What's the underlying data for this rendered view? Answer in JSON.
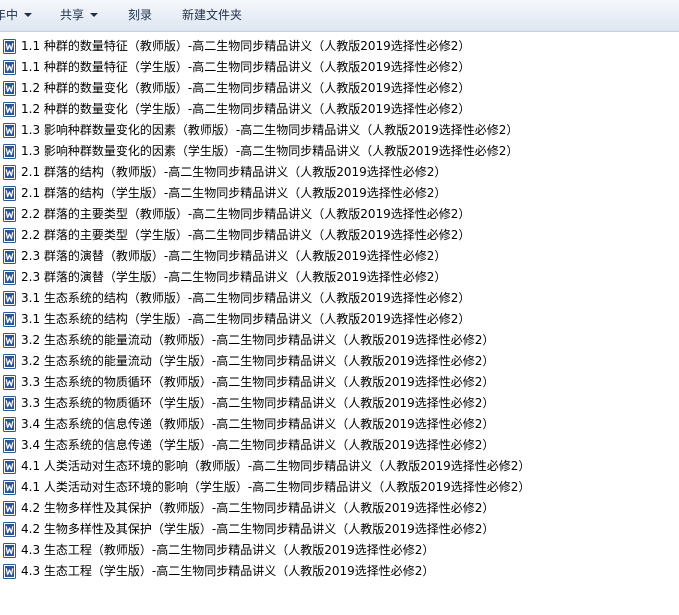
{
  "toolbar": {
    "items": [
      {
        "label": "年中",
        "dropdown": true
      },
      {
        "label": "共享",
        "dropdown": true
      },
      {
        "label": "刻录",
        "dropdown": false
      },
      {
        "label": "新建文件夹",
        "dropdown": false
      }
    ]
  },
  "files": {
    "icon": "word-document-icon",
    "icon_color": "#2b5797",
    "items": [
      {
        "name": "1.1 种群的数量特征（教师版）-高二生物同步精品讲义（人教版2019选择性必修2）"
      },
      {
        "name": "1.1 种群的数量特征（学生版）-高二生物同步精品讲义（人教版2019选择性必修2）"
      },
      {
        "name": "1.2 种群的数量变化（教师版）-高二生物同步精品讲义（人教版2019选择性必修2）"
      },
      {
        "name": "1.2 种群的数量变化（学生版）-高二生物同步精品讲义（人教版2019选择性必修2）"
      },
      {
        "name": "1.3 影响种群数量变化的因素（教师版）-高二生物同步精品讲义（人教版2019选择性必修2）"
      },
      {
        "name": "1.3 影响种群数量变化的因素（学生版）-高二生物同步精品讲义（人教版2019选择性必修2）"
      },
      {
        "name": "2.1 群落的结构（教师版）-高二生物同步精品讲义（人教版2019选择性必修2）"
      },
      {
        "name": "2.1 群落的结构（学生版）-高二生物同步精品讲义（人教版2019选择性必修2）"
      },
      {
        "name": "2.2 群落的主要类型（教师版）-高二生物同步精品讲义（人教版2019选择性必修2）"
      },
      {
        "name": "2.2 群落的主要类型（学生版）-高二生物同步精品讲义（人教版2019选择性必修2）"
      },
      {
        "name": "2.3 群落的演替（教师版）-高二生物同步精品讲义（人教版2019选择性必修2）"
      },
      {
        "name": "2.3 群落的演替（学生版）-高二生物同步精品讲义（人教版2019选择性必修2）"
      },
      {
        "name": "3.1 生态系统的结构（教师版）-高二生物同步精品讲义（人教版2019选择性必修2）"
      },
      {
        "name": "3.1 生态系统的结构（学生版）-高二生物同步精品讲义（人教版2019选择性必修2）"
      },
      {
        "name": "3.2 生态系统的能量流动（教师版）-高二生物同步精品讲义（人教版2019选择性必修2）"
      },
      {
        "name": "3.2 生态系统的能量流动（学生版）-高二生物同步精品讲义（人教版2019选择性必修2）"
      },
      {
        "name": "3.3 生态系统的物质循环（教师版）-高二生物同步精品讲义（人教版2019选择性必修2）"
      },
      {
        "name": "3.3 生态系统的物质循环（学生版）-高二生物同步精品讲义（人教版2019选择性必修2）"
      },
      {
        "name": "3.4 生态系统的信息传递（教师版）-高二生物同步精品讲义（人教版2019选择性必修2）"
      },
      {
        "name": "3.4 生态系统的信息传递（学生版）-高二生物同步精品讲义（人教版2019选择性必修2）"
      },
      {
        "name": "4.1 人类活动对生态环境的影响（教师版）-高二生物同步精品讲义（人教版2019选择性必修2）"
      },
      {
        "name": "4.1 人类活动对生态环境的影响（学生版）-高二生物同步精品讲义（人教版2019选择性必修2）"
      },
      {
        "name": "4.2 生物多样性及其保护（教师版）-高二生物同步精品讲义（人教版2019选择性必修2）"
      },
      {
        "name": "4.2 生物多样性及其保护（学生版）-高二生物同步精品讲义（人教版2019选择性必修2）"
      },
      {
        "name": "4.3 生态工程（教师版）-高二生物同步精品讲义（人教版2019选择性必修2）"
      },
      {
        "name": "4.3 生态工程（学生版）-高二生物同步精品讲义（人教版2019选择性必修2）"
      }
    ]
  }
}
